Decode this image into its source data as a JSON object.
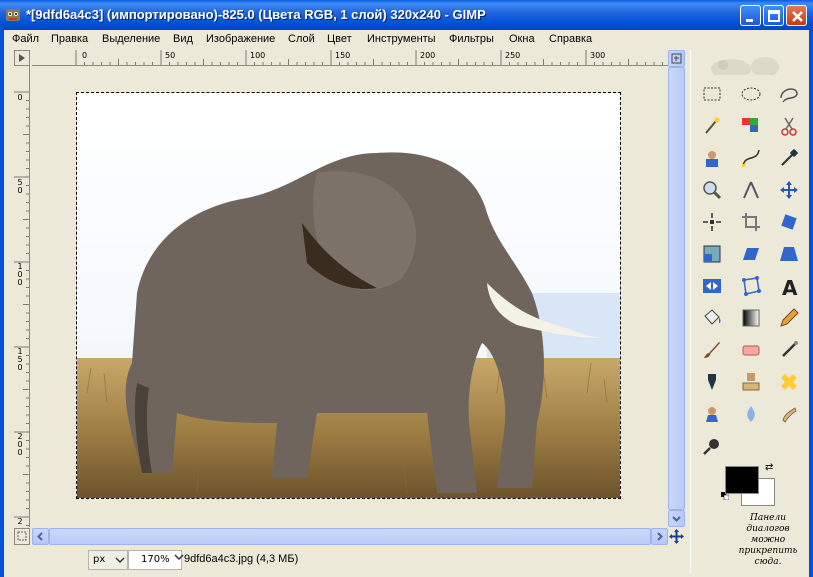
{
  "window": {
    "title": "*[9dfd6a4c3] (импортировано)-825.0 (Цвета RGB, 1 слой) 320x240 - GIMP"
  },
  "menu": {
    "items": [
      "Файл",
      "Правка",
      "Выделение",
      "Вид",
      "Изображение",
      "Слой",
      "Цвет",
      "Инструменты",
      "Фильтры",
      "Окна",
      "Справка"
    ]
  },
  "ruler": {
    "h_labels": [
      "0",
      "50",
      "100",
      "150",
      "200",
      "250",
      "300"
    ],
    "v_labels": [
      "0",
      "5\n0",
      "1\n0\n0",
      "1\n5\n0",
      "2\n0\n0",
      "2"
    ]
  },
  "status": {
    "unit": "px",
    "zoom": "170%",
    "file_info": "9dfd6a4c3.jpg (4,3 МБ)"
  },
  "toolbox": {
    "tools": [
      "rect-select-icon",
      "ellipse-select-icon",
      "free-select-icon",
      "fuzzy-select-icon",
      "select-by-color-icon",
      "scissors-icon",
      "foreground-select-icon",
      "paths-icon",
      "color-picker-icon",
      "zoom-icon",
      "measure-icon",
      "move-icon",
      "align-icon",
      "crop-icon",
      "rotate-icon",
      "scale-icon",
      "shear-icon",
      "perspective-icon",
      "flip-icon",
      "cage-icon",
      "text-icon",
      "bucket-fill-icon",
      "blend-icon",
      "pencil-icon",
      "paintbrush-icon",
      "eraser-icon",
      "airbrush-icon",
      "ink-icon",
      "clone-icon",
      "heal-icon",
      "perspective-clone-icon",
      "blur-icon",
      "smudge-icon",
      "dodge-burn-icon"
    ],
    "colors": {
      "foreground": "#000000",
      "background": "#ffffff"
    },
    "dock_hint": "Панели диалогов можно прикрепить сюда."
  }
}
